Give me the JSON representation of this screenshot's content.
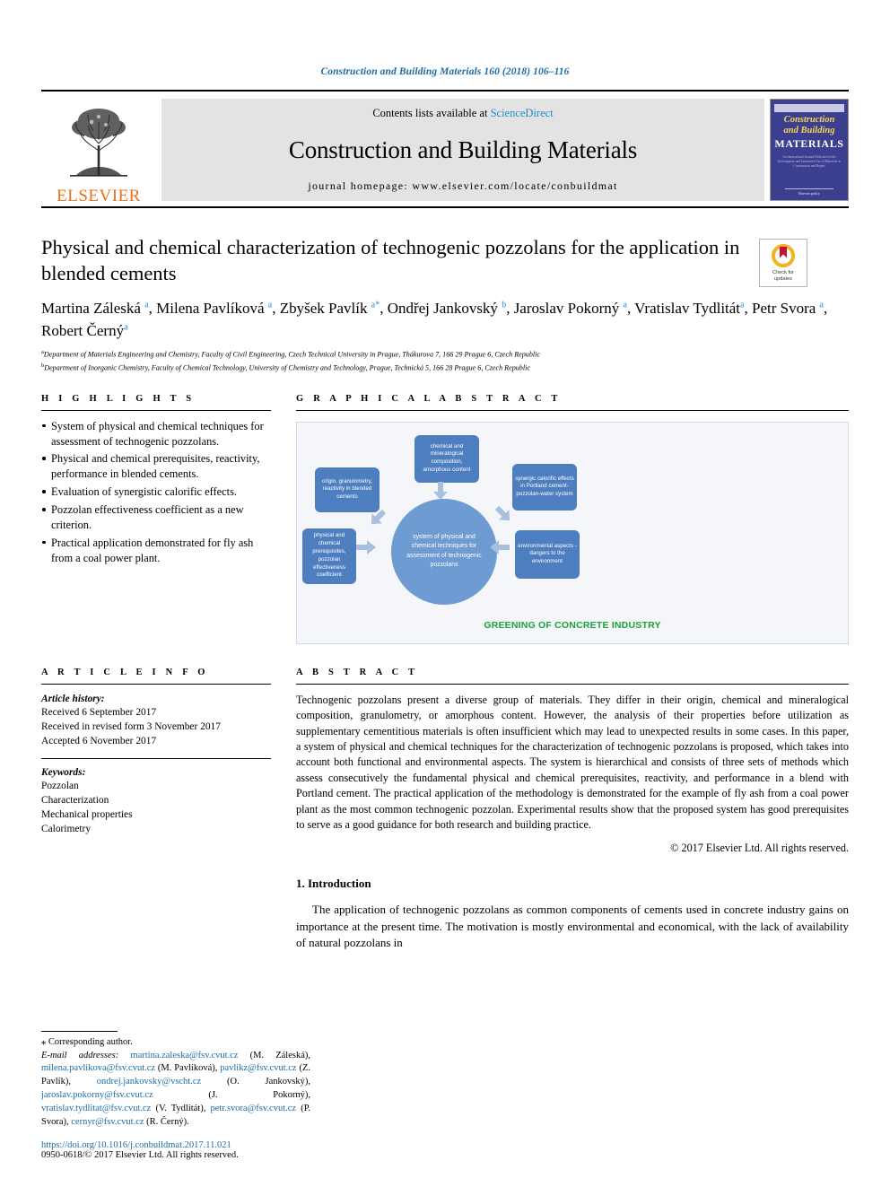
{
  "running_head": "Construction and Building Materials 160 (2018) 106–116",
  "masthead": {
    "publisher_name": "ELSEVIER",
    "publisher_logo_icon": "elsevier-tree-icon",
    "contents_line_prefix": "Contents lists available at ",
    "contents_line_link": "ScienceDirect",
    "journal_title": "Construction and Building Materials",
    "homepage_line": "journal homepage: www.elsevier.com/locate/conbuildmat",
    "cover": {
      "line1": "Construction",
      "line2": "and Building",
      "line3": "MATERIALS",
      "blurb": "An International Journal Dedicated to the Investigation and Innovative Use of Materials in Construction and Repair",
      "footer": "Elsevier policy"
    }
  },
  "article": {
    "title": "Physical and chemical characterization of technogenic pozzolans for the application in blended cements",
    "crossmark": {
      "icon": "crossmark-icon",
      "line1": "Check for",
      "line2": "updates"
    },
    "authors_html": "Martina Záleská <sup>a</sup>, Milena Pavlíková <sup>a</sup>, Zbyšek Pavlík <sup>a</sup><sup>*</sup>, Ondřej Jankovský <sup>b</sup>, Jaroslav Pokorný <sup>a</sup>, Vratislav Tydlitát<sup>a</sup>, Petr Svora <sup>a</sup>, Robert Černý<sup>a</sup>",
    "affiliations": [
      "Department of Materials Engineering and Chemistry, Faculty of Civil Engineering, Czech Technical University in Prague, Thákurova 7, 166 29 Prague 6, Czech Republic",
      "Department of Inorganic Chemistry, Faculty of Chemical Technology, University of Chemistry and Technology, Prague, Technická 5, 166 28 Prague 6, Czech Republic"
    ],
    "affiliation_markers": [
      "a",
      "b"
    ]
  },
  "highlights": {
    "heading": "H I G H L I G H T S",
    "items": [
      "System of physical and chemical techniques for assessment of technogenic pozzolans.",
      "Physical and chemical prerequisites, reactivity, performance in blended cements.",
      "Evaluation of synergistic calorific effects.",
      "Pozzolan effectiveness coefficient as a new criterion.",
      "Practical application demonstrated for fly ash from a coal power plant."
    ]
  },
  "graphical_abstract": {
    "heading": "G R A P H I C A L   A B S T R A C T",
    "center": "system of physical and chemical techniques for assessment of technogenic pozzolans",
    "boxes": [
      {
        "id": "top",
        "text": "chemical and mineralogical composition, amorphous content"
      },
      {
        "id": "left",
        "text": "origin, granulometry, reactivity in blended cements"
      },
      {
        "id": "right",
        "text": "synergic calorific effects in Portland cement-pozzolan-water system"
      },
      {
        "id": "bottom-left",
        "text": "physical and chemical prerequisites, pozzolan effectiveness coefficient"
      },
      {
        "id": "bottom-right",
        "text": "environmental aspects - dangers to the environment"
      }
    ],
    "caption": "GREENING OF CONCRETE INDUSTRY",
    "colors": {
      "box": "#4d7ebf",
      "circle": "#6e9bd2",
      "arrow": "#a8c0de",
      "caption": "#19a23a",
      "panel_bg": "#f4f6fa"
    }
  },
  "article_info": {
    "heading": "A R T I C L E   I N F O",
    "history_label": "Article history:",
    "history": [
      "Received 6 September 2017",
      "Received in revised form 3 November 2017",
      "Accepted 6 November 2017"
    ],
    "keywords_label": "Keywords:",
    "keywords": [
      "Pozzolan",
      "Characterization",
      "Mechanical properties",
      "Calorimetry"
    ]
  },
  "abstract": {
    "heading": "A B S T R A C T",
    "body": "Technogenic pozzolans present a diverse group of materials. They differ in their origin, chemical and mineralogical composition, granulometry, or amorphous content. However, the analysis of their properties before utilization as supplementary cementitious materials is often insufficient which may lead to unexpected results in some cases. In this paper, a system of physical and chemical techniques for the characterization of technogenic pozzolans is proposed, which takes into account both functional and environmental aspects. The system is hierarchical and consists of three sets of methods which assess consecutively the fundamental physical and chemical prerequisites, reactivity, and performance in a blend with Portland cement. The practical application of the methodology is demonstrated for the example of fly ash from a coal power plant as the most common technogenic pozzolan. Experimental results show that the proposed system has good prerequisites to serve as a good guidance for both research and building practice.",
    "copyright": "© 2017 Elsevier Ltd. All rights reserved."
  },
  "introduction": {
    "heading": "1. Introduction",
    "body": "The application of technogenic pozzolans as common components of cements used in concrete industry gains on importance at the present time. The motivation is mostly environmental and economical, with the lack of availability of natural pozzolans in"
  },
  "footer": {
    "corresponding_author": "⁎ Corresponding author.",
    "email_label": "E-mail addresses:",
    "emails_html": "<span class=\"lnk\">martina.zaleska@fsv.cvut.cz</span> (M. Záleská), <span class=\"lnk\">milena.pavlikova@fsv.cvut.cz</span> (M. Pavlíková), <span class=\"lnk\">pavlikz@fsv.cvut.cz</span> (Z. Pavlík), <span class=\"lnk\">ondrej.jankovsky@vscht.cz</span> (O. Jankovský), <span class=\"lnk\">jaroslav.pokorny@fsv.cvut.cz</span> (J. Pokorný), <span class=\"lnk\">vratislav.tydlitat@fsv.cvut.cz</span> (V. Tydlitát), <span class=\"lnk\">petr.svora@fsv.cvut.cz</span> (P. Svora), <span class=\"lnk\">cernyr@fsv.cvut.cz</span> (R. Černý).",
    "doi": "https://doi.org/10.1016/j.conbuildmat.2017.11.021",
    "issn": "0950-0618/© 2017 Elsevier Ltd. All rights reserved."
  }
}
